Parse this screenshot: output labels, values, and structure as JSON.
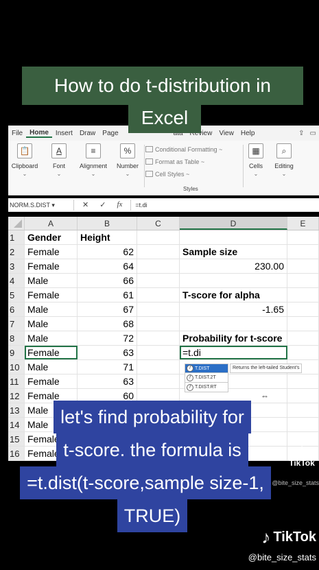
{
  "title_lines": [
    "How to do t-distribution in",
    "Excel"
  ],
  "ribbon": {
    "tabs": [
      "File",
      "Home",
      "Insert",
      "Draw",
      "Page",
      "ata",
      "Review",
      "View",
      "Help"
    ],
    "groups": {
      "clipboard": "Clipboard",
      "font": "Font",
      "alignment": "Alignment",
      "number": "Number",
      "cells": "Cells",
      "editing": "Editing"
    },
    "styles": {
      "conditional": "Conditional Formatting ~",
      "table": "Format as Table ~",
      "cell_styles": "Cell Styles ~",
      "label": "Styles"
    }
  },
  "formula_bar": {
    "name_box": "NORM.S.DIST ▾",
    "cancel": "✕",
    "enter": "✓",
    "fx": "fx",
    "value": "=t.di"
  },
  "columns": [
    "A",
    "B",
    "C",
    "D",
    "E"
  ],
  "rows": [
    {
      "n": "1",
      "a": "Gender",
      "b": "Height",
      "d": ""
    },
    {
      "n": "2",
      "a": "Female",
      "b": "62",
      "d": "Sample size"
    },
    {
      "n": "3",
      "a": "Female",
      "b": "64",
      "d": "230.00"
    },
    {
      "n": "4",
      "a": "Male",
      "b": "66",
      "d": ""
    },
    {
      "n": "5",
      "a": "Female",
      "b": "61",
      "d": "T-score for alpha"
    },
    {
      "n": "6",
      "a": "Male",
      "b": "67",
      "d": "-1.65"
    },
    {
      "n": "7",
      "a": "Male",
      "b": "68",
      "d": ""
    },
    {
      "n": "8",
      "a": "Male",
      "b": "72",
      "d": "Probability for t-score"
    },
    {
      "n": "9",
      "a": "Female",
      "b": "63",
      "d": "=t.di"
    },
    {
      "n": "10",
      "a": "Male",
      "b": "71",
      "d": ""
    },
    {
      "n": "11",
      "a": "Female",
      "b": "63",
      "d": ""
    },
    {
      "n": "12",
      "a": "Female",
      "b": "60",
      "d": ""
    },
    {
      "n": "13",
      "a": "Male",
      "b": "",
      "d": ""
    },
    {
      "n": "14",
      "a": "Male",
      "b": "",
      "d": ""
    },
    {
      "n": "15",
      "a": "Female",
      "b": "",
      "d": ""
    },
    {
      "n": "16",
      "a": "Female",
      "b": "",
      "d": ""
    }
  ],
  "autocomplete": {
    "items": [
      "T.DIST",
      "T.DIST.2T",
      "T.DIST.RT"
    ],
    "tooltip": "Returns the left-tailed Student's"
  },
  "caption_lines": [
    "let's find probability for",
    "t-score. the formula is",
    "=t.dist(t-score,sample size-1,",
    "TRUE)"
  ],
  "watermark": {
    "brand": "TikTok",
    "handle": "@bite_size_stats"
  },
  "colors": {
    "title_bg": "#3a5f40",
    "caption_bg": "#2f44a0",
    "excel_green": "#217346"
  }
}
